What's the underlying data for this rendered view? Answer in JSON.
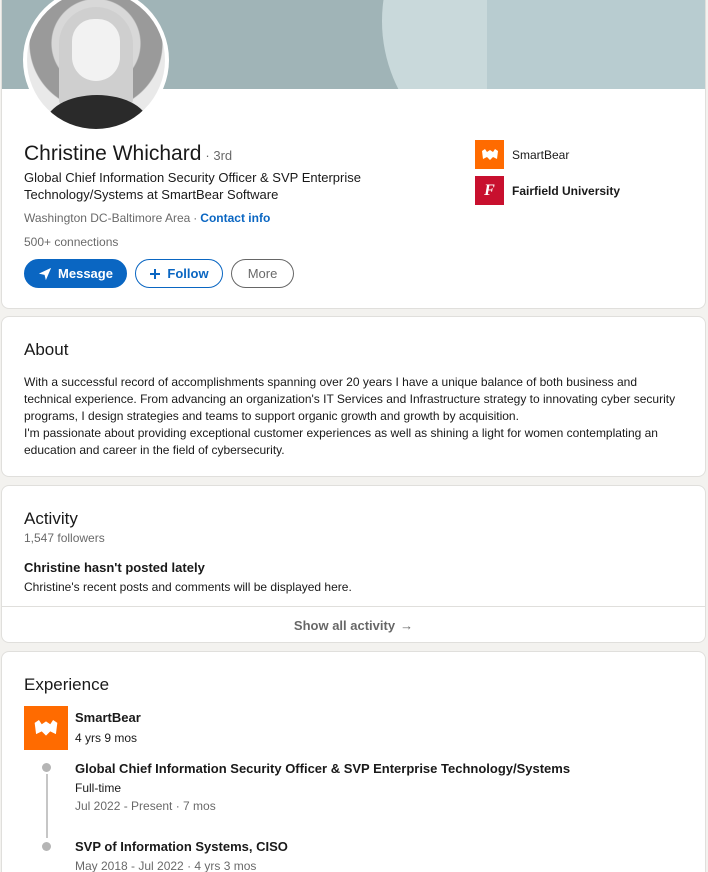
{
  "profile": {
    "name": "Christine Whichard",
    "degree": "· 3rd",
    "headline": "Global Chief Information Security Officer & SVP Enterprise Technology/Systems at SmartBear Software",
    "location": "Washington DC-Baltimore Area",
    "location_sep": "·",
    "contact_info": "Contact info",
    "connections": "500+ connections"
  },
  "actions": {
    "message_label": "Message",
    "follow_label": "Follow",
    "more_label": "More"
  },
  "orgs": [
    {
      "name": "SmartBear",
      "icon": "smartbear-logo"
    },
    {
      "name": "Fairfield University",
      "icon": "fairfield-logo",
      "logo_text": "F"
    }
  ],
  "about": {
    "title": "About",
    "text_1": "With a successful record of accomplishments spanning over 20 years I have a unique balance of both business and technical experience. From advancing an organization's IT Services and Infrastructure strategy to innovating cyber security programs, I design strategies and teams to support organic growth and growth by acquisition.",
    "text_2": "I'm passionate about providing exceptional customer experiences as well as shining a light for women contemplating an education and career in the field of cybersecurity."
  },
  "activity": {
    "title": "Activity",
    "followers": "1,547 followers",
    "no_posts_title": "Christine hasn't posted lately",
    "no_posts_sub": "Christine's recent posts and comments will be displayed here.",
    "show_all": "Show all activity",
    "show_all_arrow": "→"
  },
  "experience": {
    "title": "Experience",
    "company": "SmartBear",
    "duration": "4 yrs 9 mos",
    "roles": [
      {
        "title": "Global Chief Information Security Officer & SVP Enterprise Technology/Systems",
        "type": "Full-time",
        "dates": "Jul 2022 - Present · 7 mos"
      },
      {
        "title": "SVP of Information Systems, CISO",
        "dates": "May 2018 - Jul 2022 · 4 yrs 3 mos"
      }
    ]
  },
  "colors": {
    "accent": "#0a66c2",
    "smartbear": "#ff6b00",
    "fairfield": "#c8102e"
  }
}
